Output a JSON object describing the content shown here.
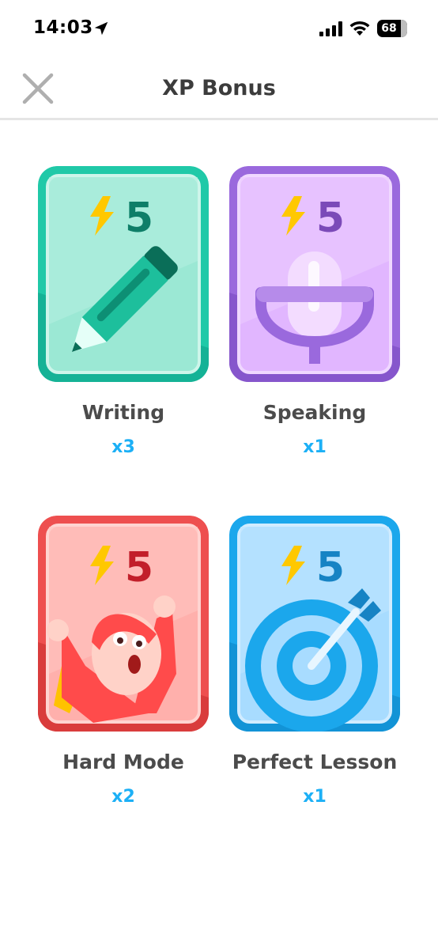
{
  "status_bar": {
    "time": "14:03",
    "battery": "68"
  },
  "header": {
    "title": "XP Bonus"
  },
  "cards": [
    {
      "label": "Writing",
      "count": "x3",
      "xp": "5",
      "icon": "pencil-icon",
      "color": "#1dcfb0"
    },
    {
      "label": "Speaking",
      "count": "x1",
      "xp": "5",
      "icon": "microphone-icon",
      "color": "#9a69dd"
    },
    {
      "label": "Hard Mode",
      "count": "x2",
      "xp": "5",
      "icon": "cheering-character-icon",
      "color": "#ee4f4f"
    },
    {
      "label": "Perfect Lesson",
      "count": "x1",
      "xp": "5",
      "icon": "target-icon",
      "color": "#1ba7ec"
    }
  ]
}
